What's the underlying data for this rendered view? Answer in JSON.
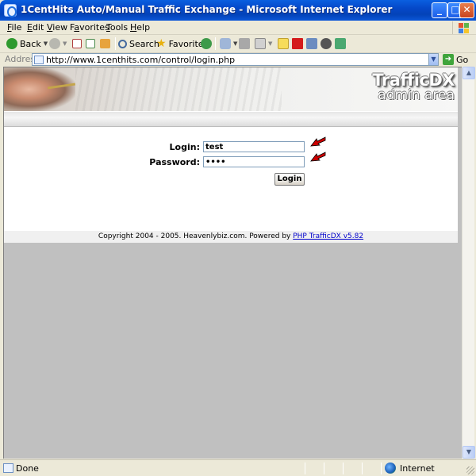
{
  "window": {
    "title": "1CentHits Auto/Manual Traffic Exchange - Microsoft Internet Explorer",
    "minimize": "_",
    "maximize": "□",
    "close": "✕"
  },
  "menu": {
    "items": [
      "File",
      "Edit",
      "View",
      "Favorites",
      "Tools",
      "Help"
    ],
    "underlined": [
      "F",
      "E",
      "V",
      "a",
      "T",
      "H"
    ]
  },
  "toolbar": {
    "back": "Back",
    "search": "Search",
    "favorites": "Favorites"
  },
  "address": {
    "label": "Address",
    "url": "http://www.1centhits.com/control/login.php",
    "go": "Go"
  },
  "banner": {
    "brand": "TrafficDX",
    "subtitle": "admin area"
  },
  "form": {
    "login_label": "Login:",
    "login_value": "test",
    "password_label": "Password:",
    "password_value": "••••",
    "submit_label": "Login"
  },
  "footer": {
    "text": "Copyright 2004 - 2005. Heavenlybiz.com. Powered by ",
    "link": "PHP TrafficDX v5.82"
  },
  "status": {
    "text": "Done",
    "zone": "Internet"
  },
  "colors": {
    "titlebar": "#0548c8",
    "chrome": "#ece9d8",
    "viewport_bg": "#c0c0c0",
    "link": "#0000cc",
    "arrow": "#cc0000"
  }
}
